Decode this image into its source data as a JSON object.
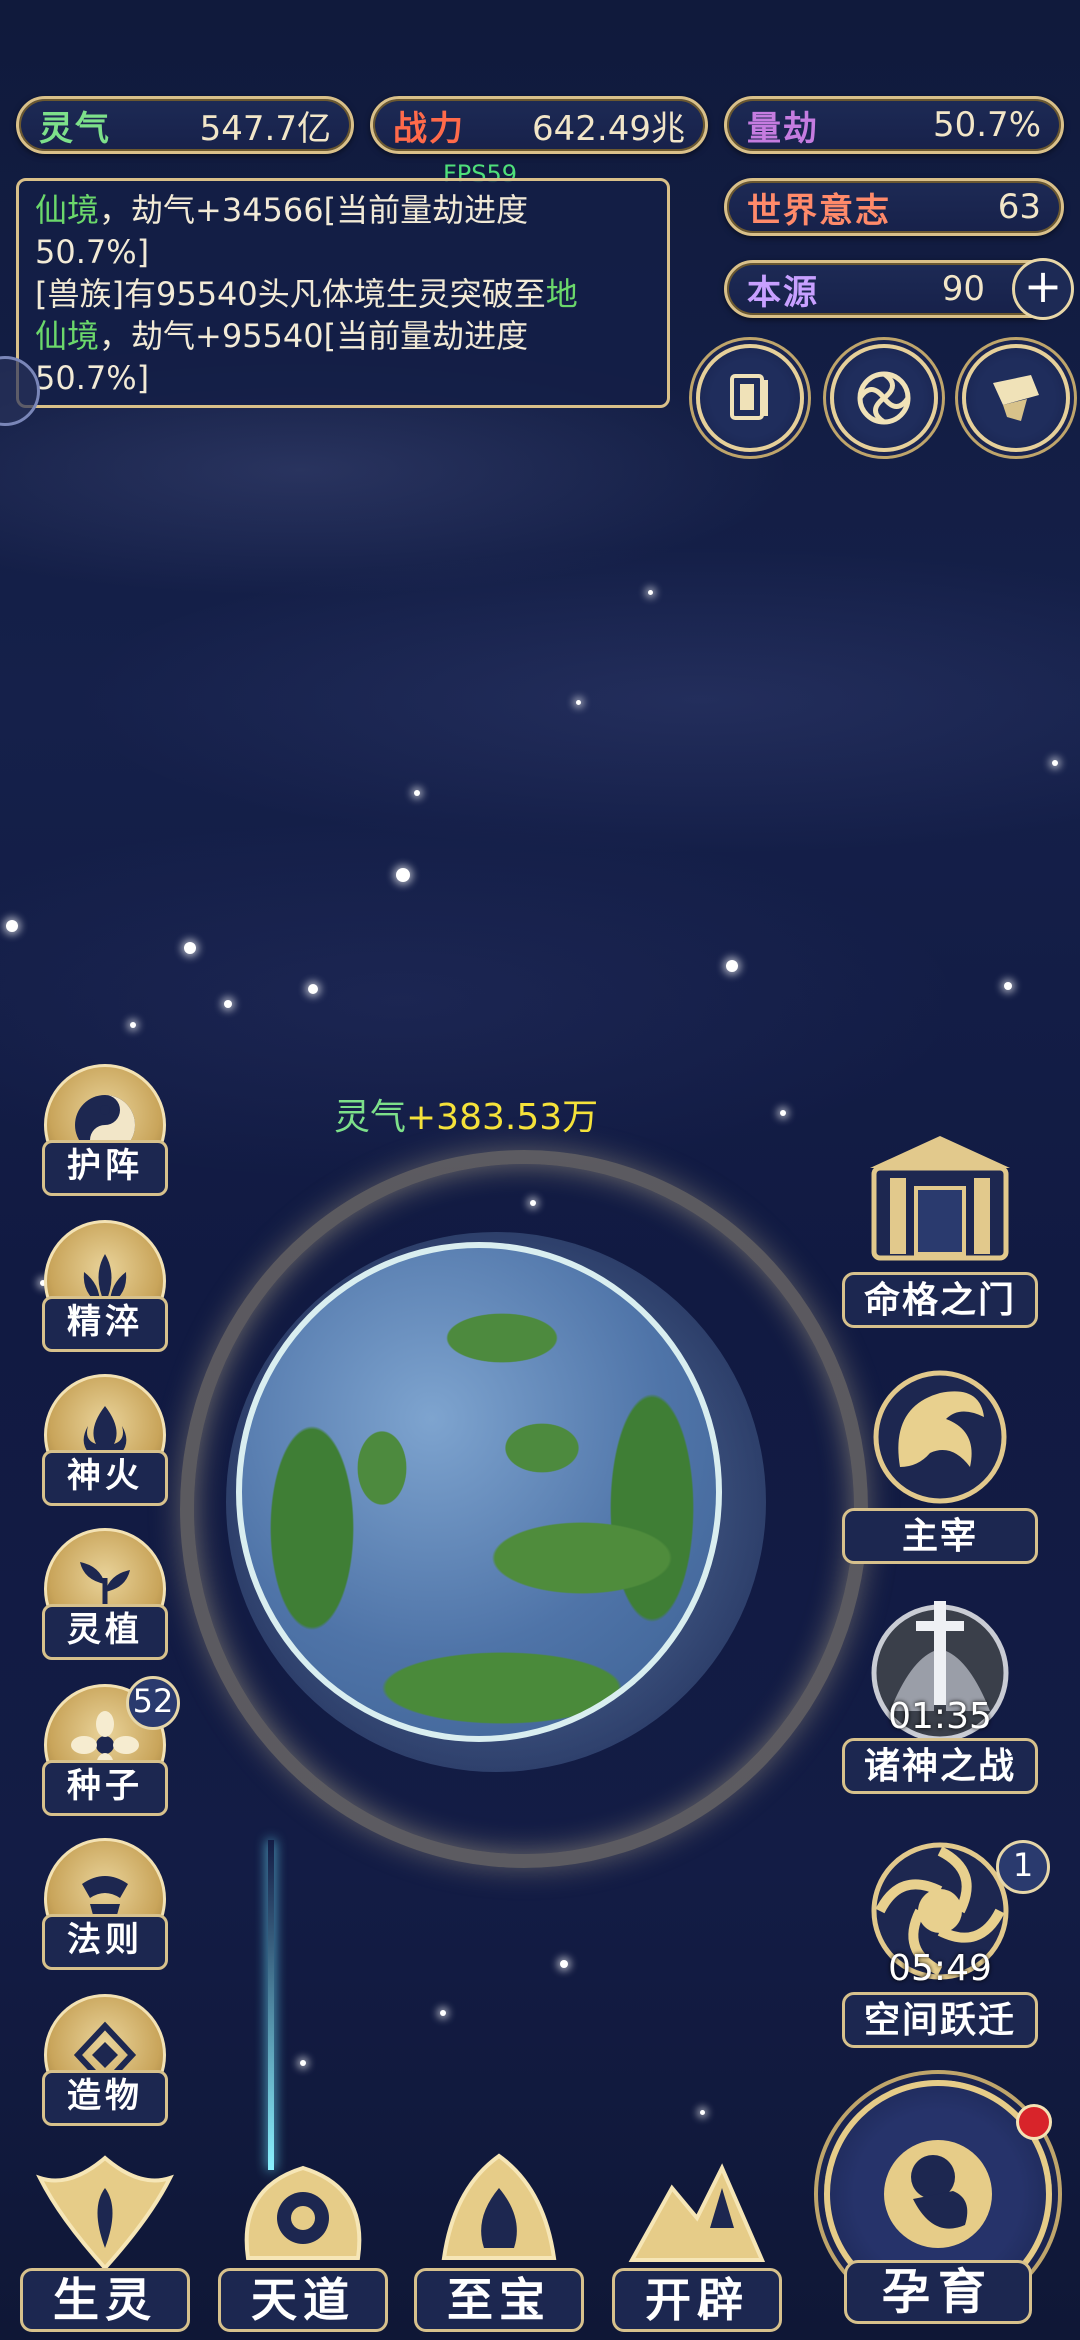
{
  "stats": {
    "lingqi": {
      "label": "灵气",
      "value": "547.7亿"
    },
    "zhanli": {
      "label": "战力",
      "value": "642.49兆"
    },
    "liangjie": {
      "label": "量劫",
      "value": "50.7%"
    },
    "shijie": {
      "label": "世界意志",
      "value": "63"
    },
    "benyuan": {
      "label": "本源",
      "value": "90"
    }
  },
  "fps": "FPS59",
  "log": {
    "l1a": "仙境",
    "l1b": "，劫气+34566[当前量劫进度",
    "l2": "50.7%]",
    "l3a": "[兽族]有95540头凡体境生灵突破至",
    "l3b": "地",
    "l4a": "仙境",
    "l4b": "，劫气+95540[当前量劫进度",
    "l5": "50.7%]"
  },
  "gain_text": {
    "label": "灵气",
    "value": "+383.53万"
  },
  "left_menu": [
    "护阵",
    "精淬",
    "神火",
    "灵植",
    "种子",
    "法则",
    "造物"
  ],
  "seed_count": "52",
  "right_menu": {
    "mingge": "命格之门",
    "zhuzai": "主宰",
    "zhushen": {
      "label": "诸神之战",
      "timer": "01:35"
    },
    "kongjian": {
      "label": "空间跃迁",
      "timer": "05:49",
      "badge": "1"
    }
  },
  "bottom_menu": [
    "生灵",
    "天道",
    "至宝",
    "开辟",
    "孕育"
  ],
  "colors": {
    "gold": "#d9c089",
    "panel": "#1c2750",
    "green": "#6bd86b",
    "yellow": "#f5e23a"
  }
}
